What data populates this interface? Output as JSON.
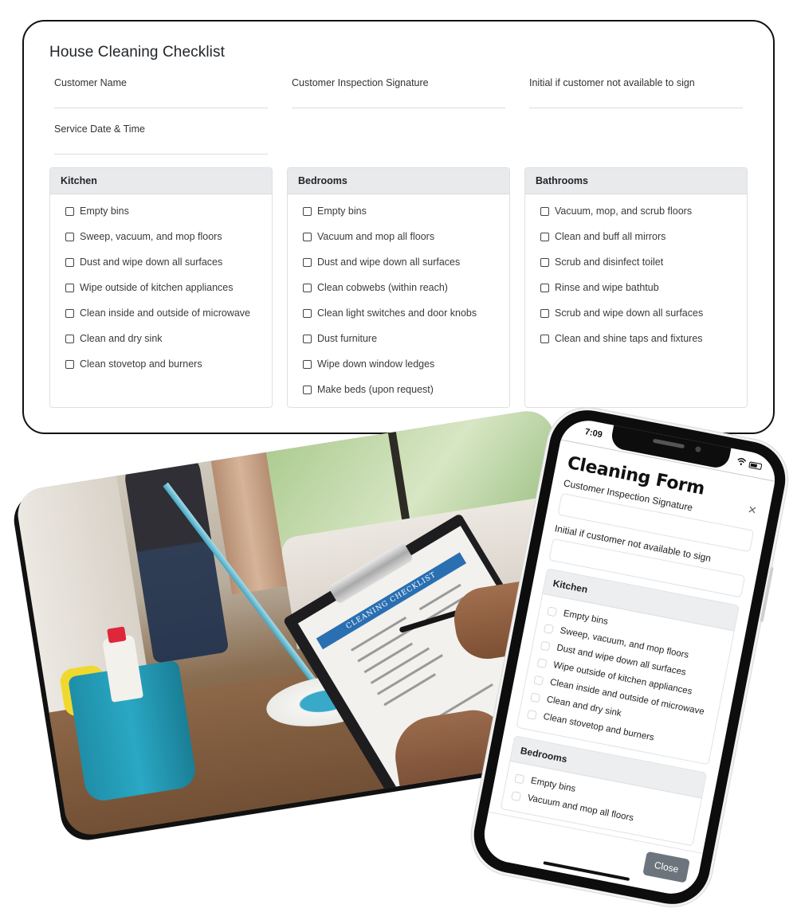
{
  "desktop_form": {
    "title": "House Cleaning Checklist",
    "fields": [
      {
        "label": "Customer Name",
        "value": ""
      },
      {
        "label": "Customer Inspection Signature",
        "value": ""
      },
      {
        "label": "Initial if customer not available to sign",
        "value": ""
      },
      {
        "label": "Service Date & Time",
        "value": ""
      }
    ],
    "sections": [
      {
        "title": "Kitchen",
        "items": [
          {
            "label": "Empty bins",
            "checked": false
          },
          {
            "label": "Sweep, vacuum, and mop floors",
            "checked": false
          },
          {
            "label": "Dust and wipe down all surfaces",
            "checked": false
          },
          {
            "label": "Wipe outside of kitchen appliances",
            "checked": false
          },
          {
            "label": "Clean inside and outside of microwave",
            "checked": false
          },
          {
            "label": "Clean and dry sink",
            "checked": false
          },
          {
            "label": "Clean stovetop and burners",
            "checked": false
          }
        ]
      },
      {
        "title": "Bedrooms",
        "items": [
          {
            "label": "Empty bins",
            "checked": false
          },
          {
            "label": "Vacuum and mop all floors",
            "checked": false
          },
          {
            "label": "Dust and wipe down all surfaces",
            "checked": false
          },
          {
            "label": "Clean cobwebs (within reach)",
            "checked": false
          },
          {
            "label": "Clean light switches and door knobs",
            "checked": false
          },
          {
            "label": "Dust furniture",
            "checked": false
          },
          {
            "label": "Wipe down window ledges",
            "checked": false
          },
          {
            "label": "Make beds (upon request)",
            "checked": false
          }
        ]
      },
      {
        "title": "Bathrooms",
        "items": [
          {
            "label": "Vacuum, mop, and scrub floors",
            "checked": false
          },
          {
            "label": "Clean and buff all mirrors",
            "checked": false
          },
          {
            "label": "Scrub and disinfect toilet",
            "checked": false
          },
          {
            "label": "Rinse and wipe bathtub",
            "checked": false
          },
          {
            "label": "Scrub and wipe down all surfaces",
            "checked": false
          },
          {
            "label": "Clean and shine taps and fixtures",
            "checked": false
          }
        ]
      }
    ]
  },
  "photo": {
    "description": "Person mopping floor with cleaning bucket; hand holding clipboard with checklist",
    "clipboard_heading": "CLEANING CHECKLIST"
  },
  "phone": {
    "status_time": "7:09",
    "status_icons": [
      "wifi-icon",
      "battery-icon"
    ],
    "title": "Cleaning Form",
    "close_icon": "×",
    "fields": [
      {
        "label": "Customer Inspection Signature",
        "value": ""
      },
      {
        "label": "Initial if customer not available to sign",
        "value": ""
      }
    ],
    "sections": [
      {
        "title": "Kitchen",
        "items": [
          {
            "label": "Empty bins",
            "checked": false
          },
          {
            "label": "Sweep, vacuum, and mop floors",
            "checked": false
          },
          {
            "label": "Dust and wipe down all surfaces",
            "checked": false
          },
          {
            "label": "Wipe outside of kitchen appliances",
            "checked": false
          },
          {
            "label": "Clean inside and outside of microwave",
            "checked": false
          },
          {
            "label": "Clean and dry sink",
            "checked": false
          },
          {
            "label": "Clean stovetop and burners",
            "checked": false
          }
        ]
      },
      {
        "title": "Bedrooms",
        "items": [
          {
            "label": "Empty bins",
            "checked": false
          },
          {
            "label": "Vacuum and mop all floors",
            "checked": false
          }
        ]
      }
    ],
    "close_button_label": "Close",
    "close_button_color": "#6c757d"
  }
}
